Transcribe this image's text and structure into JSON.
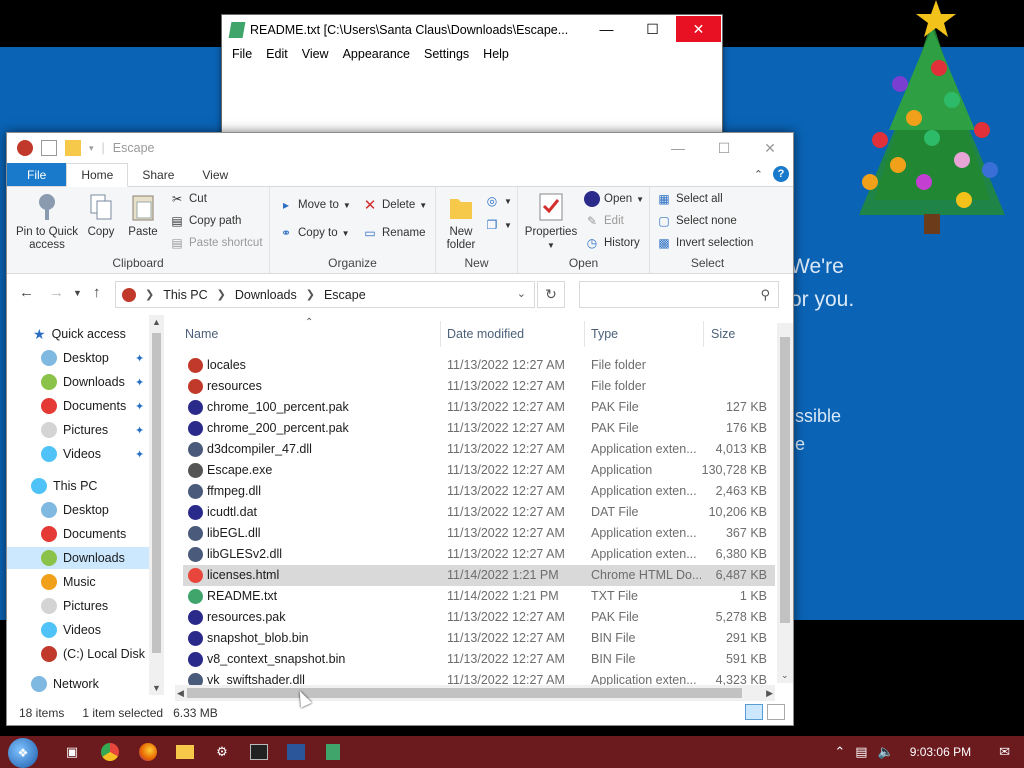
{
  "background_app": {
    "line1": "We're",
    "line2": "or you.",
    "line3": "ssible",
    "line4": "e"
  },
  "notepad": {
    "title": "README.txt [C:\\Users\\Santa Claus\\Downloads\\Escape...",
    "menu": [
      "File",
      "Edit",
      "View",
      "Appearance",
      "Settings",
      "Help"
    ]
  },
  "explorer": {
    "title": "Escape",
    "tabs": [
      "File",
      "Home",
      "Share",
      "View"
    ],
    "ribbon": {
      "clipboard": {
        "label": "Clipboard",
        "pin": "Pin to Quick access",
        "copy": "Copy",
        "paste": "Paste",
        "cut": "Cut",
        "copy_path": "Copy path",
        "paste_shortcut": "Paste shortcut"
      },
      "organize": {
        "label": "Organize",
        "move_to": "Move to",
        "copy_to": "Copy to",
        "delete": "Delete",
        "rename": "Rename"
      },
      "new": {
        "label": "New",
        "new_folder": "New folder"
      },
      "open": {
        "label": "Open",
        "properties": "Properties",
        "open": "Open",
        "edit": "Edit",
        "history": "History"
      },
      "select": {
        "label": "Select",
        "select_all": "Select all",
        "select_none": "Select none",
        "invert": "Invert selection"
      }
    },
    "breadcrumb": [
      "This PC",
      "Downloads",
      "Escape"
    ],
    "nav": {
      "quick_access": "Quick access",
      "quick_items": [
        "Desktop",
        "Downloads",
        "Documents",
        "Pictures",
        "Videos"
      ],
      "this_pc": "This PC",
      "pc_items": [
        "Desktop",
        "Documents",
        "Downloads",
        "Music",
        "Pictures",
        "Videos",
        "(C:) Local Disk"
      ],
      "network": "Network"
    },
    "columns": {
      "name": "Name",
      "date": "Date modified",
      "type": "Type",
      "size": "Size"
    },
    "files": [
      {
        "name": "locales",
        "date": "11/13/2022 12:27 AM",
        "type": "File folder",
        "size": "",
        "icon": "folder-icon",
        "color": "#c0392b"
      },
      {
        "name": "resources",
        "date": "11/13/2022 12:27 AM",
        "type": "File folder",
        "size": "",
        "icon": "folder-icon",
        "color": "#c0392b"
      },
      {
        "name": "chrome_100_percent.pak",
        "date": "11/13/2022 12:27 AM",
        "type": "PAK File",
        "size": "127 KB",
        "icon": "pak-file-icon",
        "color": "#2a2a8a"
      },
      {
        "name": "chrome_200_percent.pak",
        "date": "11/13/2022 12:27 AM",
        "type": "PAK File",
        "size": "176 KB",
        "icon": "pak-file-icon",
        "color": "#2a2a8a"
      },
      {
        "name": "d3dcompiler_47.dll",
        "date": "11/13/2022 12:27 AM",
        "type": "Application exten...",
        "size": "4,013 KB",
        "icon": "dll-file-icon",
        "color": "#4a5a7a"
      },
      {
        "name": "Escape.exe",
        "date": "11/13/2022 12:27 AM",
        "type": "Application",
        "size": "130,728 KB",
        "icon": "exe-file-icon",
        "color": "#555555"
      },
      {
        "name": "ffmpeg.dll",
        "date": "11/13/2022 12:27 AM",
        "type": "Application exten...",
        "size": "2,463 KB",
        "icon": "dll-file-icon",
        "color": "#4a5a7a"
      },
      {
        "name": "icudtl.dat",
        "date": "11/13/2022 12:27 AM",
        "type": "DAT File",
        "size": "10,206 KB",
        "icon": "dat-file-icon",
        "color": "#2a2a8a"
      },
      {
        "name": "libEGL.dll",
        "date": "11/13/2022 12:27 AM",
        "type": "Application exten...",
        "size": "367 KB",
        "icon": "dll-file-icon",
        "color": "#4a5a7a"
      },
      {
        "name": "libGLESv2.dll",
        "date": "11/13/2022 12:27 AM",
        "type": "Application exten...",
        "size": "6,380 KB",
        "icon": "dll-file-icon",
        "color": "#4a5a7a"
      },
      {
        "name": "licenses.html",
        "date": "11/14/2022 1:21 PM",
        "type": "Chrome HTML Do...",
        "size": "6,487 KB",
        "icon": "chrome-icon",
        "color": "#e8453c",
        "selected": true
      },
      {
        "name": "README.txt",
        "date": "11/14/2022 1:21 PM",
        "type": "TXT File",
        "size": "1 KB",
        "icon": "txt-file-icon",
        "color": "#3fa56b"
      },
      {
        "name": "resources.pak",
        "date": "11/13/2022 12:27 AM",
        "type": "PAK File",
        "size": "5,278 KB",
        "icon": "pak-file-icon",
        "color": "#2a2a8a"
      },
      {
        "name": "snapshot_blob.bin",
        "date": "11/13/2022 12:27 AM",
        "type": "BIN File",
        "size": "291 KB",
        "icon": "bin-file-icon",
        "color": "#2a2a8a"
      },
      {
        "name": "v8_context_snapshot.bin",
        "date": "11/13/2022 12:27 AM",
        "type": "BIN File",
        "size": "591 KB",
        "icon": "bin-file-icon",
        "color": "#2a2a8a"
      },
      {
        "name": "vk_swiftshader.dll",
        "date": "11/13/2022 12:27 AM",
        "type": "Application exten...",
        "size": "4,323 KB",
        "icon": "dll-file-icon",
        "color": "#4a5a7a"
      }
    ],
    "status": {
      "count": "18 items",
      "selected": "1 item selected",
      "size": "6.33 MB"
    }
  },
  "taskbar": {
    "clock": "9:03:06 PM"
  },
  "colors": {
    "desktop_blue": "#0a63b5",
    "taskbar": "#6b1a1e",
    "accent": "#1979ca",
    "close_red": "#e81123",
    "selection": "#cce8ff"
  }
}
